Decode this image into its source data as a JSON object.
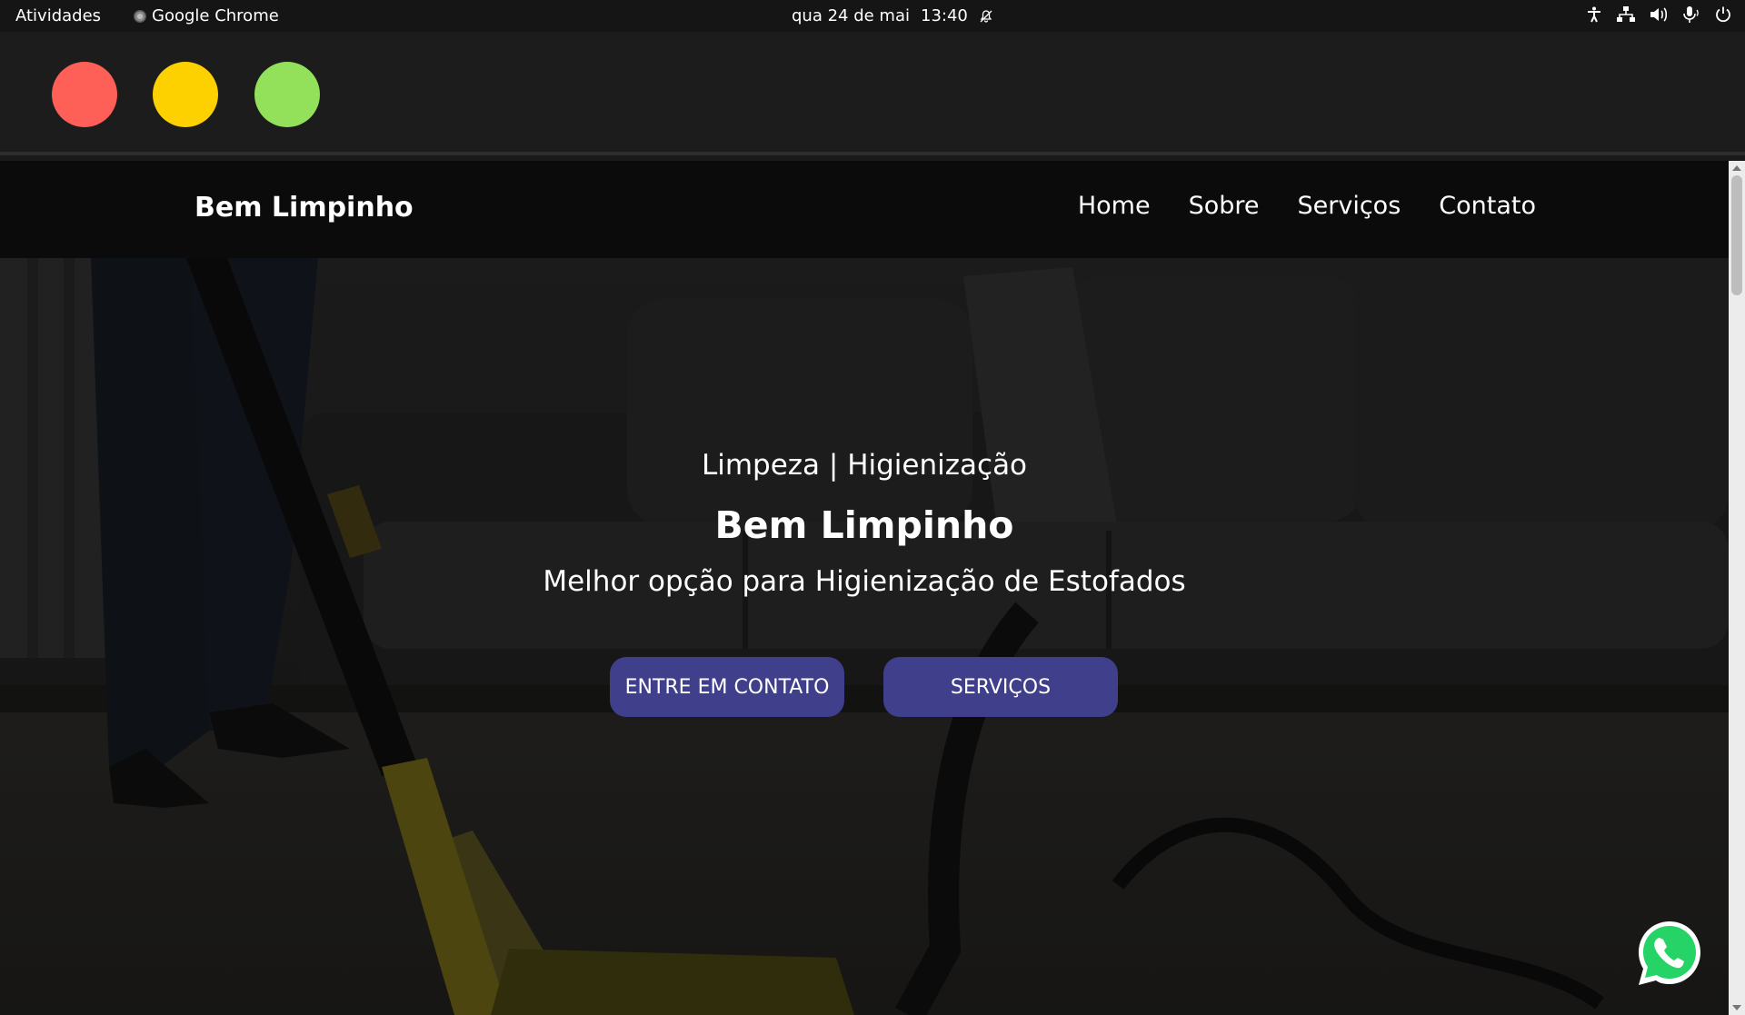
{
  "os_topbar": {
    "activities": "Atividades",
    "app_name": "Google Chrome",
    "date": "qua 24 de mai",
    "time": "13:40"
  },
  "window": {
    "traffic_lights": [
      "close",
      "minimize",
      "maximize"
    ]
  },
  "site": {
    "brand": "Bem Limpinho",
    "nav": [
      "Home",
      "Sobre",
      "Serviços",
      "Contato"
    ]
  },
  "hero": {
    "eyebrow": "Limpeza | Higienização",
    "title": "Bem Limpinho",
    "subtitle": "Melhor opção para Higienização de Estofados",
    "buttons": {
      "contact": "ENTRE EM CONTATO",
      "services": "SERVIÇOS"
    }
  },
  "colors": {
    "button": "#3f3f8c",
    "whatsapp": "#25d366"
  }
}
